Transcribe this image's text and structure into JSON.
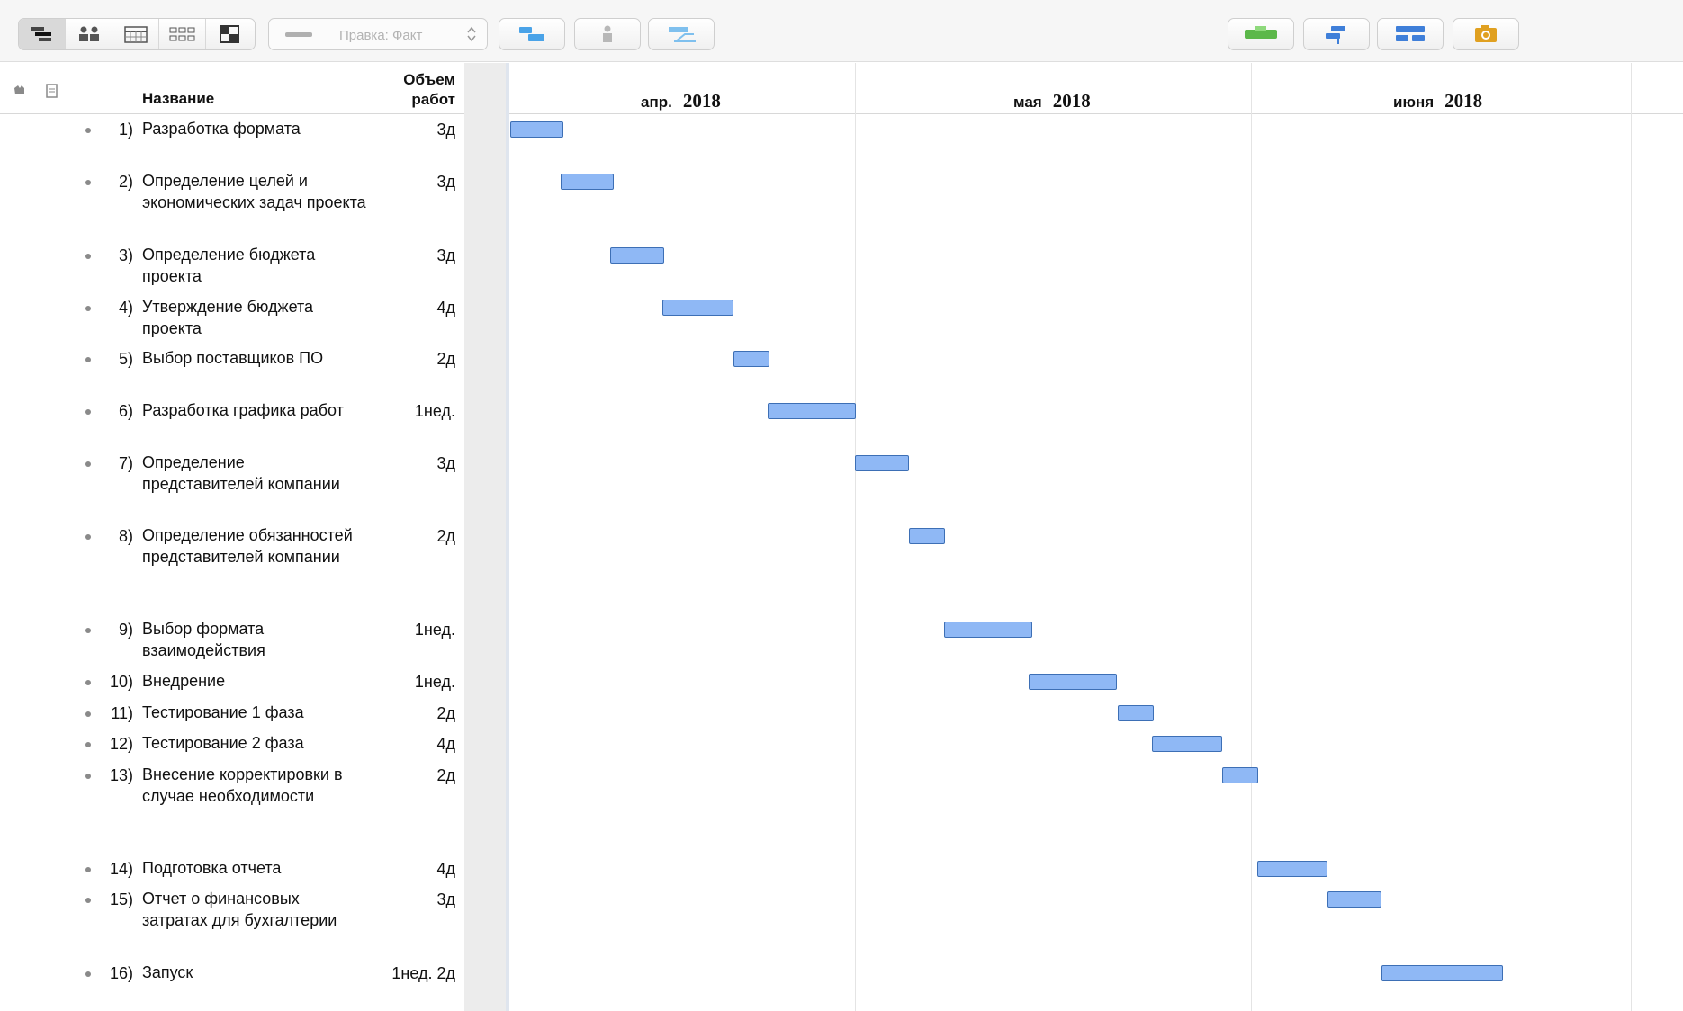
{
  "toolbar": {
    "view_modes": [
      "gantt-view-icon",
      "resources-view-icon",
      "calendar-view-icon",
      "network-view-icon",
      "split-view-icon"
    ],
    "baseline_label": "Правка: Факт",
    "action_icons": [
      "critical-path-icon",
      "assign-resource-icon",
      "baseline-icon"
    ],
    "right_icons": [
      "new-task-icon",
      "outline-icon",
      "gantt-options-icon",
      "snapshot-icon"
    ]
  },
  "columns": {
    "name": "Название",
    "work_line1": "Объем",
    "work_line2": "работ"
  },
  "timeline": {
    "months": [
      {
        "month": "апр.",
        "year": "2018"
      },
      {
        "month": "мая",
        "year": "2018"
      },
      {
        "month": "июня",
        "year": "2018"
      }
    ]
  },
  "tasks": [
    {
      "num": "1)",
      "name": "Разработка формата",
      "work": "3д"
    },
    {
      "num": "2)",
      "name": "Определение целей и экономических задач проекта",
      "work": "3д"
    },
    {
      "num": "3)",
      "name": "Определение бюджета проекта",
      "work": "3д"
    },
    {
      "num": "4)",
      "name": "Утверждение бюджета проекта",
      "work": "4д"
    },
    {
      "num": "5)",
      "name": "Выбор поставщиков ПО",
      "work": "2д"
    },
    {
      "num": "6)",
      "name": "Разработка графика работ",
      "work": "1нед."
    },
    {
      "num": "7)",
      "name": "Определение представителей компании",
      "work": "3д"
    },
    {
      "num": "8)",
      "name": "Определение обязанностей представителей компании",
      "work": "2д"
    },
    {
      "num": "9)",
      "name": "Выбор формата взаимодействия",
      "work": "1нед."
    },
    {
      "num": "10)",
      "name": "Внедрение",
      "work": "1нед."
    },
    {
      "num": "11)",
      "name": "Тестирование 1 фаза",
      "work": "2д"
    },
    {
      "num": "12)",
      "name": "Тестирование 2 фаза",
      "work": "4д"
    },
    {
      "num": "13)",
      "name": "Внесение корректировки в случае необходимости",
      "work": "2д"
    },
    {
      "num": "14)",
      "name": "Подготовка отчета",
      "work": "4д"
    },
    {
      "num": "15)",
      "name": "Отчет о финансовых затратах для бухгалтерии",
      "work": "3д"
    },
    {
      "num": "16)",
      "name": "Запуск",
      "work": "1нед. 2д"
    }
  ],
  "colors": {
    "bar_fill": "#8fb8f5",
    "bar_border": "#3d6fb5",
    "accent_green": "#5cb84a",
    "accent_blue": "#3f7fd9",
    "accent_orange": "#e0a020"
  }
}
